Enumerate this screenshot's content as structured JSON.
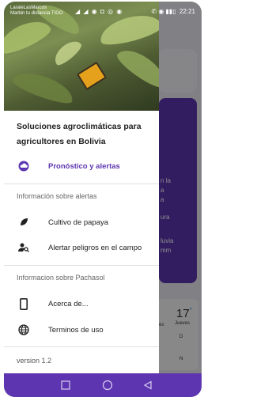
{
  "status_bar": {
    "carrier_line1": "LaraleLasMarcos",
    "carrier_line2": "Marbin tu distancia TIGO",
    "signal_icons": "◢ ◢ ◉ ◘ ◎ ◉",
    "right_icons": "✆ ◉ ▮▮▯",
    "time": "22:21"
  },
  "drawer": {
    "title": "Soluciones agroclimáticas para agricultores en Bolivia",
    "items": [
      {
        "label": "Pronóstico y alertas",
        "icon": "cloud-icon"
      },
      {
        "label": "Cultivo de papaya",
        "icon": "leaf-icon"
      },
      {
        "label": "Alertar peligros en el campo",
        "icon": "person-search-icon"
      },
      {
        "label": "Acerca de...",
        "icon": "phone-icon"
      },
      {
        "label": "Terminos de uso",
        "icon": "globe-icon"
      }
    ],
    "section_alerts": "Información sobre alertas",
    "section_pachasol": "Informacion sobre Pachasol",
    "version": "version 1.2"
  },
  "background": {
    "purple_text": [
      "n la",
      "a",
      "a",
      "ura",
      "luvia",
      "mm"
    ],
    "forecast_temp": "17",
    "forecast_deg": "°",
    "forecast_day": "Jueves",
    "forecast_day_marker": "D",
    "forecast_night_marker": "N",
    "partial_label": "es"
  },
  "colors": {
    "accent": "#5e35b1",
    "navbar": "#5e35b1"
  },
  "navbar": {
    "icons": [
      "recents-square-icon",
      "home-circle-icon",
      "back-triangle-icon"
    ]
  }
}
